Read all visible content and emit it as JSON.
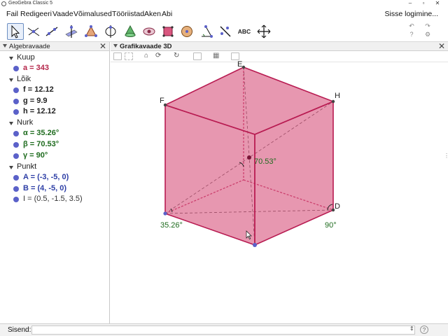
{
  "window": {
    "title": "GeoGebra Classic 5",
    "min_icon": "minimize-icon",
    "max_icon": "maximize-icon",
    "close_icon": "close-icon"
  },
  "menu": {
    "items": [
      "Fail",
      "Redigeeri",
      "Vaade",
      "Võimalused",
      "Tööriistad",
      "Aken",
      "Abi"
    ],
    "login": "Sisse logimine..."
  },
  "toolbar": {
    "tools": [
      "move-tool",
      "point-tool",
      "line-tool",
      "perpendicular-line-tool",
      "polygon-tool",
      "circle-tool",
      "intersect-plane-tool",
      "pyramid-tool",
      "sphere-tool",
      "rotate-view-tool",
      "angle-tool",
      "reflect-tool",
      "text-tool",
      "translate-view-tool"
    ],
    "text_tool_label": "ABC",
    "undo_icon": "undo-icon",
    "redo_icon": "redo-icon",
    "help_icon": "help-icon",
    "settings_icon": "settings-icon"
  },
  "algebra": {
    "title": "Algebravaade",
    "groups": [
      {
        "label": "Kuup",
        "items": [
          {
            "text": "a = 343",
            "color": "#b5264a"
          }
        ]
      },
      {
        "label": "Lõik",
        "items": [
          {
            "text": "f = 12.12",
            "color": "#222222"
          },
          {
            "text": "g = 9.9",
            "color": "#222222"
          },
          {
            "text": "h = 12.12",
            "color": "#222222"
          }
        ]
      },
      {
        "label": "Nurk",
        "items": [
          {
            "text": "α = 35.26°",
            "color": "#1e6b1e"
          },
          {
            "text": "β = 70.53°",
            "color": "#1e6b1e"
          },
          {
            "text": "γ = 90°",
            "color": "#1e6b1e"
          }
        ]
      },
      {
        "label": "Punkt",
        "items": [
          {
            "text": "A = (-3, -5, 0)",
            "color": "#2e3fa6"
          },
          {
            "text": "B = (4, -5, 0)",
            "color": "#2e3fa6"
          },
          {
            "text": "I = (0.5, -1.5, 3.5)",
            "color": "#333333"
          }
        ]
      }
    ]
  },
  "graphics": {
    "title": "Grafikavaade 3D",
    "point_labels": {
      "E": "E",
      "F": "F",
      "H": "H",
      "D": "D"
    },
    "angle_labels": {
      "alpha": "35.26°",
      "beta": "70.53°",
      "gamma": "90°"
    },
    "cube_fill": "#d9577f",
    "cube_edge": "#b81c52"
  },
  "input": {
    "label": "Sisend:",
    "value": ""
  }
}
